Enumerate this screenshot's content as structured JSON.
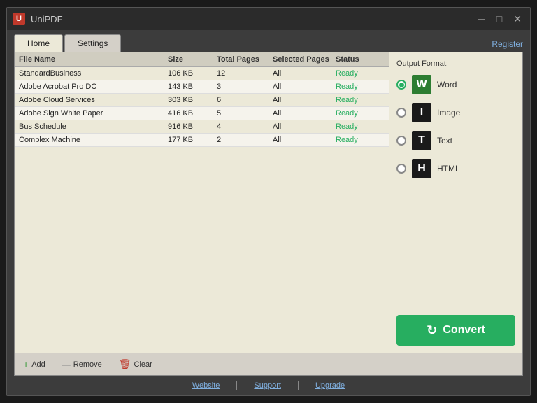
{
  "titleBar": {
    "appIcon": "U",
    "title": "UniPDF",
    "minimizeBtn": "─",
    "maximizeBtn": "□",
    "closeBtn": "✕"
  },
  "tabs": [
    {
      "id": "home",
      "label": "Home",
      "active": true
    },
    {
      "id": "settings",
      "label": "Settings",
      "active": false
    }
  ],
  "registerLink": "Register",
  "table": {
    "headers": [
      "File Name",
      "Size",
      "Total Pages",
      "Selected Pages",
      "Status"
    ],
    "rows": [
      {
        "name": "StandardBusiness",
        "size": "106 KB",
        "totalPages": "12",
        "selectedPages": "All",
        "status": "Ready"
      },
      {
        "name": "Adobe Acrobat Pro DC",
        "size": "143 KB",
        "totalPages": "3",
        "selectedPages": "All",
        "status": "Ready"
      },
      {
        "name": "Adobe Cloud Services",
        "size": "303 KB",
        "totalPages": "6",
        "selectedPages": "All",
        "status": "Ready"
      },
      {
        "name": "Adobe Sign White Paper",
        "size": "416 KB",
        "totalPages": "5",
        "selectedPages": "All",
        "status": "Ready"
      },
      {
        "name": "Bus Schedule",
        "size": "916 KB",
        "totalPages": "4",
        "selectedPages": "All",
        "status": "Ready"
      },
      {
        "name": "Complex Machine",
        "size": "177 KB",
        "totalPages": "2",
        "selectedPages": "All",
        "status": "Ready"
      }
    ]
  },
  "toolbar": {
    "addLabel": "Add",
    "removeLabel": "Remove",
    "clearLabel": "Clear"
  },
  "outputFormat": {
    "label": "Output Format:",
    "options": [
      {
        "id": "word",
        "label": "Word",
        "icon": "W",
        "selected": true
      },
      {
        "id": "image",
        "label": "Image",
        "icon": "I",
        "selected": false
      },
      {
        "id": "text",
        "label": "Text",
        "icon": "T",
        "selected": false
      },
      {
        "id": "html",
        "label": "HTML",
        "icon": "H",
        "selected": false
      }
    ]
  },
  "convertBtn": "Convert",
  "footer": {
    "links": [
      "Website",
      "Support",
      "Upgrade"
    ]
  }
}
